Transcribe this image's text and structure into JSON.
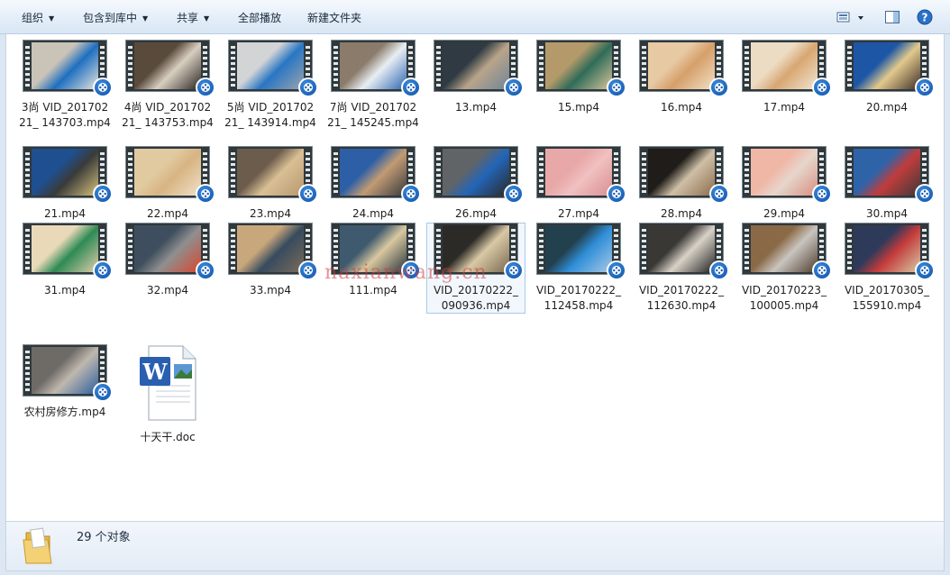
{
  "toolbar": {
    "organize": "组织",
    "include_in_library": "包含到库中",
    "share": "共享",
    "play_all": "全部播放",
    "new_folder": "新建文件夹",
    "icons": [
      "view-options-icon",
      "preview-pane-icon",
      "help-icon"
    ]
  },
  "files": [
    {
      "name": "3尚 VID_20170221_ 143703.mp4",
      "type": "video",
      "thumb": [
        "#c9c3b8",
        "#1f6fc0",
        "#e8e6df"
      ]
    },
    {
      "name": "4尚 VID_20170221_ 143753.mp4",
      "type": "video",
      "thumb": [
        "#5a4a3b",
        "#d8cfc0",
        "#2b2623"
      ]
    },
    {
      "name": "5尚 VID_20170221_ 143914.mp4",
      "type": "video",
      "thumb": [
        "#d2d4d6",
        "#2976c4",
        "#9aa4ad"
      ]
    },
    {
      "name": "7尚 VID_20170221_ 145245.mp4",
      "type": "video",
      "thumb": [
        "#8a7b6a",
        "#e9eef3",
        "#2a64b0"
      ]
    },
    {
      "name": "13.mp4",
      "type": "video",
      "thumb": [
        "#2f3a42",
        "#b9a48a",
        "#6f8598"
      ]
    },
    {
      "name": "15.mp4",
      "type": "video",
      "thumb": [
        "#b49a6a",
        "#2f6c58",
        "#d7c49b"
      ]
    },
    {
      "name": "16.mp4",
      "type": "video",
      "thumb": [
        "#e7c9a3",
        "#d69f6a",
        "#f2e1c6"
      ]
    },
    {
      "name": "17.mp4",
      "type": "video",
      "thumb": [
        "#ecdcc3",
        "#d8a771",
        "#f1e6d4"
      ]
    },
    {
      "name": "20.mp4",
      "type": "video",
      "thumb": [
        "#1d56a5",
        "#e3c98c",
        "#3e2f2a"
      ]
    },
    {
      "name": "21.mp4",
      "type": "video",
      "thumb": [
        "#1f4f8f",
        "#3a3b38",
        "#d6c27e"
      ]
    },
    {
      "name": "22.mp4",
      "type": "video",
      "thumb": [
        "#e1c9a0",
        "#d8b482",
        "#efe1c9"
      ]
    },
    {
      "name": "23.mp4",
      "type": "video",
      "thumb": [
        "#6c5c4c",
        "#d9bf94",
        "#b89770"
      ]
    },
    {
      "name": "24.mp4",
      "type": "video",
      "thumb": [
        "#2d5fa7",
        "#c29b72",
        "#373a3f"
      ]
    },
    {
      "name": "26.mp4",
      "type": "video",
      "thumb": [
        "#606467",
        "#2365b8",
        "#2a2a2a"
      ]
    },
    {
      "name": "27.mp4",
      "type": "video",
      "thumb": [
        "#e8a8a8",
        "#f1c0c0",
        "#d88f92"
      ]
    },
    {
      "name": "28.mp4",
      "type": "video",
      "thumb": [
        "#1f1c19",
        "#cfbfa6",
        "#8a6c4d"
      ]
    },
    {
      "name": "29.mp4",
      "type": "video",
      "thumb": [
        "#f0b6a6",
        "#e7d6cc",
        "#d68f80"
      ]
    },
    {
      "name": "30.mp4",
      "type": "video",
      "thumb": [
        "#2e63a8",
        "#c03c3c",
        "#3c3a38"
      ]
    },
    {
      "name": "31.mp4",
      "type": "video",
      "thumb": [
        "#ead9b9",
        "#2d8a55",
        "#e2cfac"
      ]
    },
    {
      "name": "32.mp4",
      "type": "video",
      "thumb": [
        "#3e4e5e",
        "#8f8f8f",
        "#d7472f"
      ]
    },
    {
      "name": "33.mp4",
      "type": "video",
      "thumb": [
        "#c9a77c",
        "#364b5e",
        "#7d6c5a"
      ]
    },
    {
      "name": "111.mp4",
      "type": "video",
      "thumb": [
        "#3f5a6e",
        "#d9c79f",
        "#27343d"
      ]
    },
    {
      "name": "VID_20170222_ 090936.mp4",
      "type": "video",
      "thumb": [
        "#2c2a26",
        "#d9c9a5",
        "#7a6852"
      ],
      "selected": true
    },
    {
      "name": "VID_20170222_ 112458.mp4",
      "type": "video",
      "thumb": [
        "#23404f",
        "#2f8fd8",
        "#a9c8e6"
      ]
    },
    {
      "name": "VID_20170222_ 112630.mp4",
      "type": "video",
      "thumb": [
        "#3a3835",
        "#d9d2c7",
        "#202020"
      ]
    },
    {
      "name": "VID_20170223_ 100005.mp4",
      "type": "video",
      "thumb": [
        "#8a6a46",
        "#c9c5bf",
        "#4e3d2e"
      ]
    },
    {
      "name": "VID_20170305_ 155910.mp4",
      "type": "video",
      "thumb": [
        "#2d3a5a",
        "#c33b3b",
        "#d8c9a6"
      ]
    },
    {
      "name": "农村房修方.mp4",
      "type": "video",
      "thumb": [
        "#6e6a66",
        "#bfb8ae",
        "#2c5ea0"
      ]
    },
    {
      "name": "十天干.doc",
      "type": "doc"
    }
  ],
  "status": {
    "count_text": "29 个对象",
    "folder_icon": "folder-icon"
  },
  "watermark": "naxianwang.cn"
}
